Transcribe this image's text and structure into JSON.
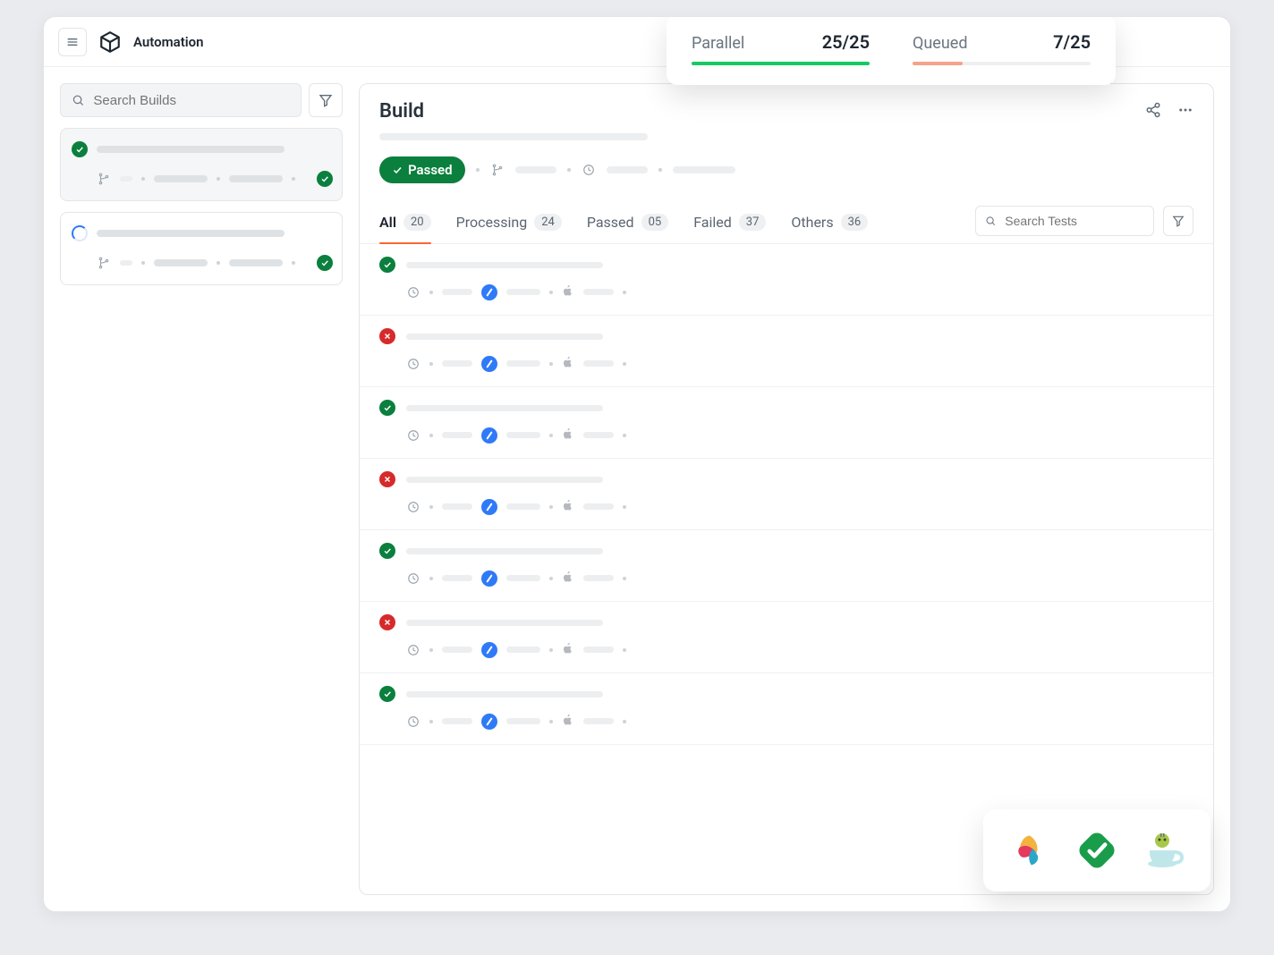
{
  "header": {
    "app_title": "Automation"
  },
  "stats": {
    "parallel": {
      "label": "Parallel",
      "value": "25/25"
    },
    "queued": {
      "label": "Queued",
      "value": "7/25"
    }
  },
  "sidebar": {
    "search_placeholder": "Search Builds",
    "builds": [
      {
        "status": "pass",
        "corner": "pass",
        "selected": true
      },
      {
        "status": "running",
        "corner": "pass",
        "selected": false
      }
    ]
  },
  "build": {
    "title": "Build",
    "status_label": "Passed"
  },
  "tabs": [
    {
      "key": "all",
      "label": "All",
      "count": "20",
      "active": true
    },
    {
      "key": "processing",
      "label": "Processing",
      "count": "24",
      "active": false
    },
    {
      "key": "passed",
      "label": "Passed",
      "count": "05",
      "active": false
    },
    {
      "key": "failed",
      "label": "Failed",
      "count": "37",
      "active": false
    },
    {
      "key": "others",
      "label": "Others",
      "count": "36",
      "active": false
    }
  ],
  "tests_search_placeholder": "Search Tests",
  "tests": [
    {
      "status": "pass"
    },
    {
      "status": "fail"
    },
    {
      "status": "pass"
    },
    {
      "status": "fail"
    },
    {
      "status": "pass"
    },
    {
      "status": "fail"
    },
    {
      "status": "pass"
    }
  ],
  "integrations": [
    "appium",
    "katalon",
    "espresso"
  ]
}
